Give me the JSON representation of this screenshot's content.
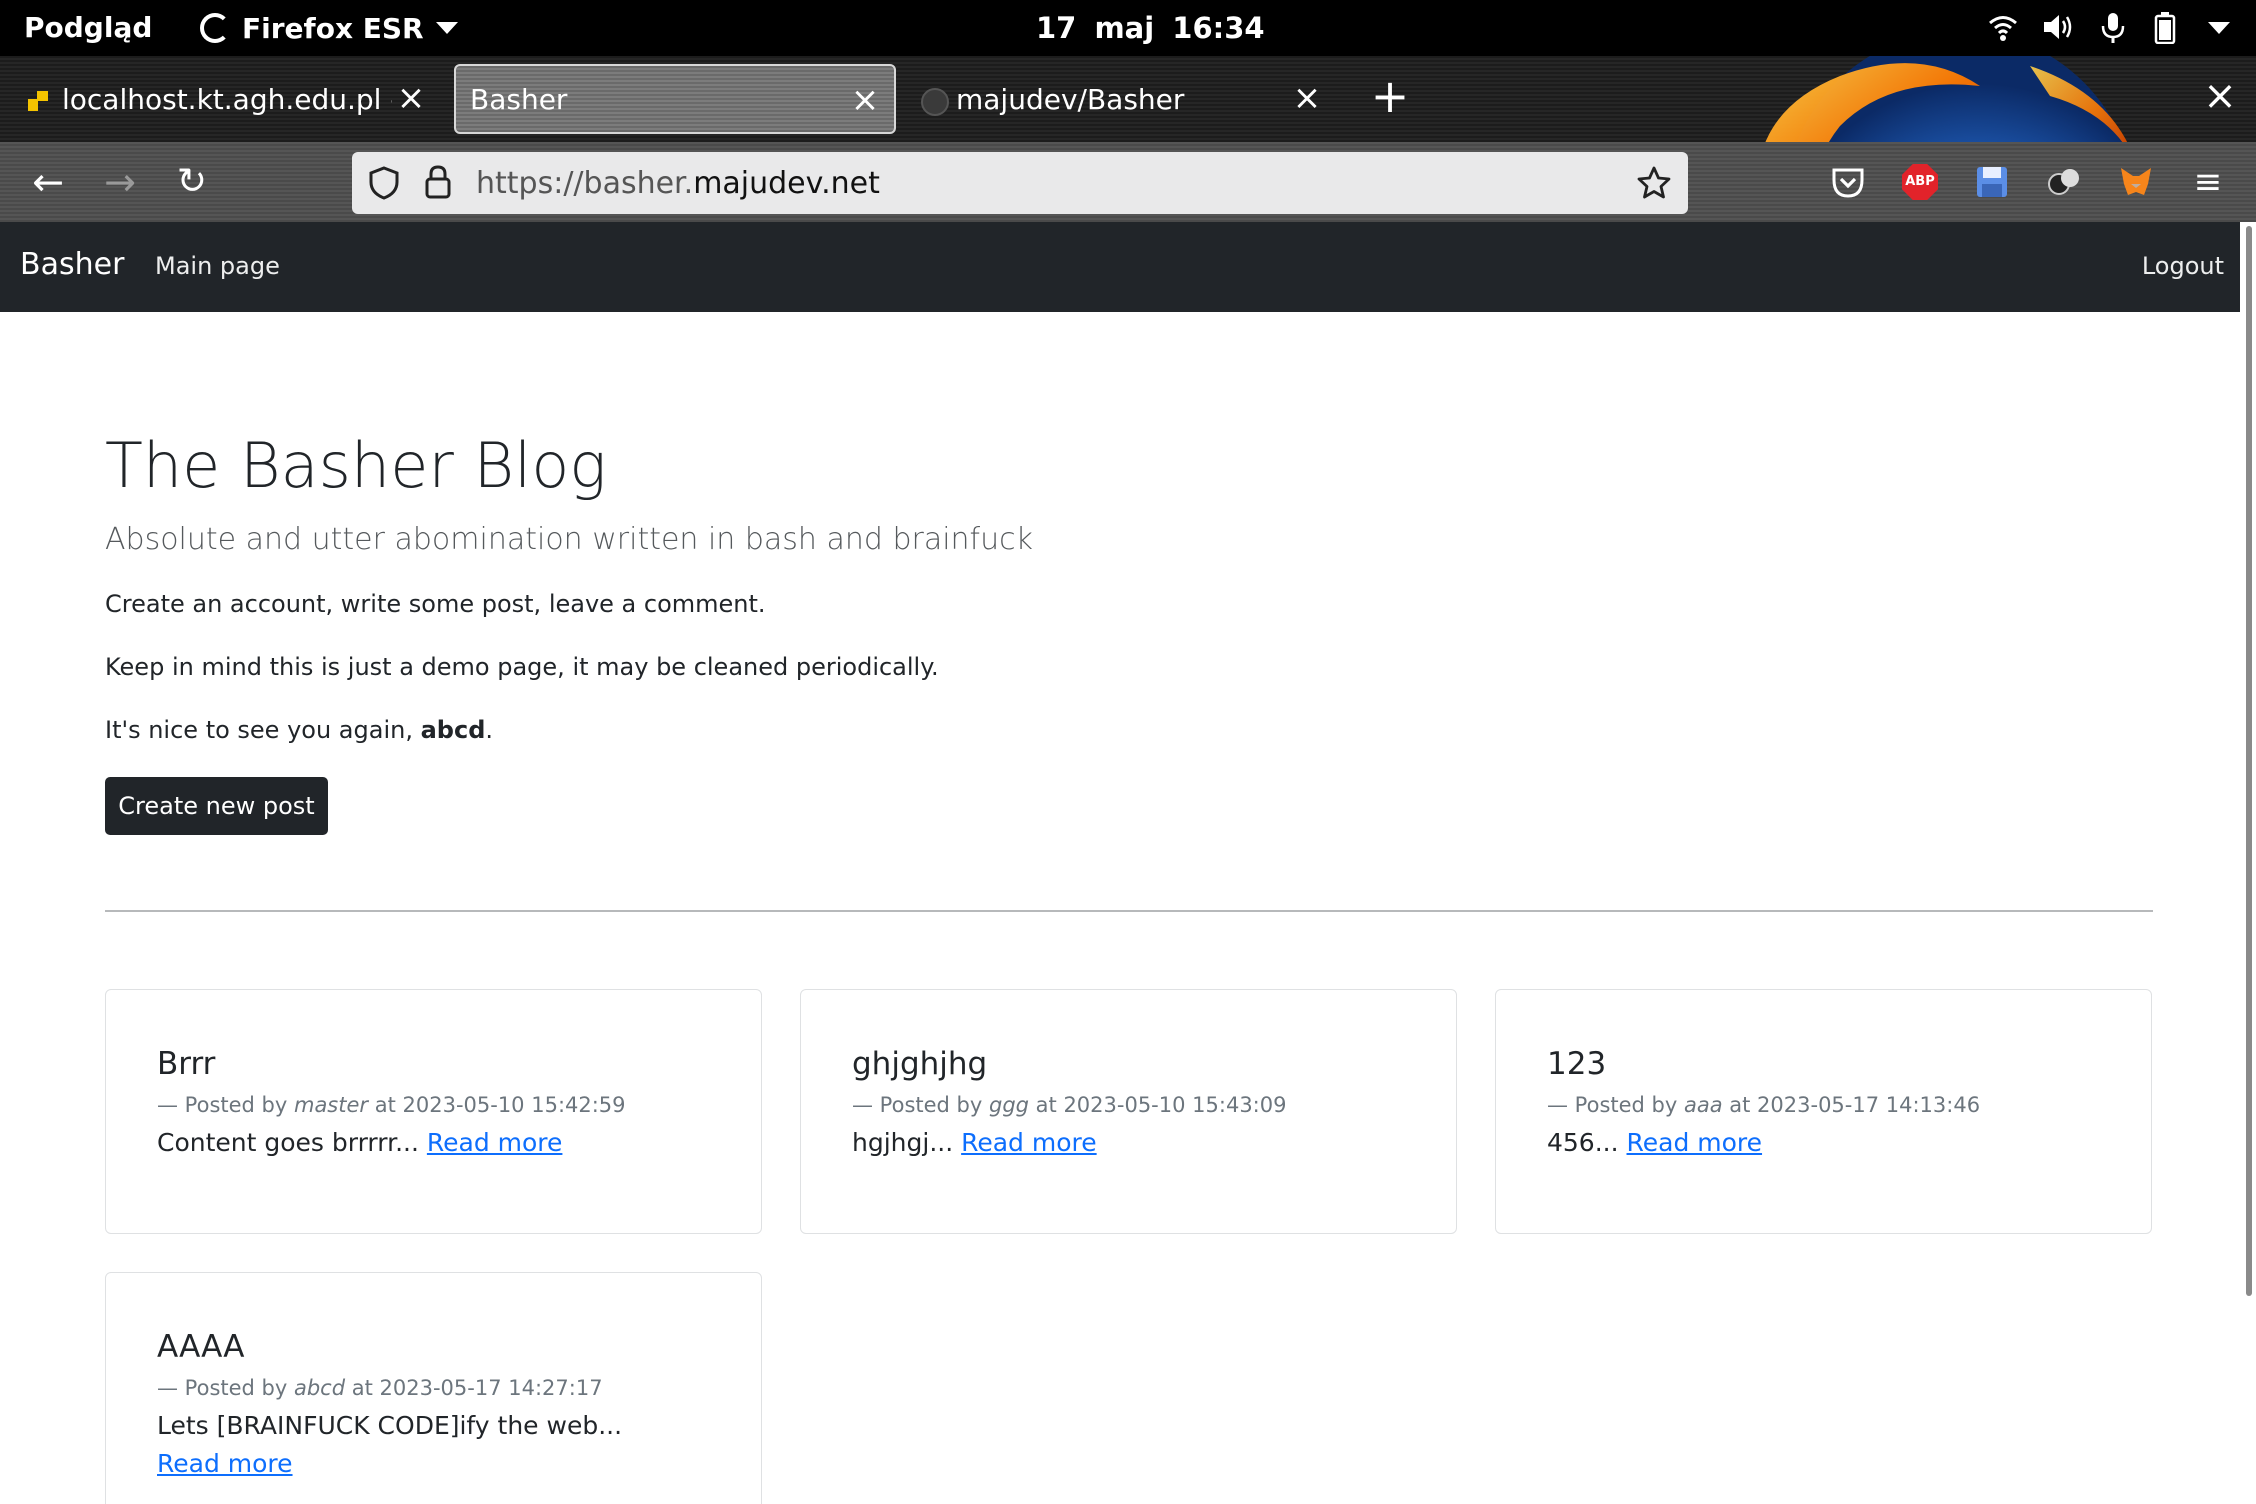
{
  "system_bar": {
    "activities": "Podgląd",
    "app_name": "Firefox ESR",
    "clock": "17 maj  16:34"
  },
  "browser": {
    "tabs": [
      {
        "label": "localhost.kt.agh.edu.pl - V",
        "active": false
      },
      {
        "label": "Basher",
        "active": true
      },
      {
        "label": "majudev/Basher",
        "active": false
      }
    ],
    "url_prefix": "https://basher.",
    "url_domain": "majudev.net",
    "extensions": [
      "pocket-icon",
      "adblock-plus-icon",
      "floppy-save-icon",
      "balls-extension-icon",
      "metamask-fox-icon"
    ],
    "extension_adblock_label": "ABP"
  },
  "site": {
    "brand": "Basher",
    "nav_main": "Main page",
    "nav_logout": "Logout",
    "title": "The Basher Blog",
    "lead": "Absolute and utter abomination written in bash and brainfuck",
    "p1": "Create an account, write some post, leave a comment.",
    "p2": "Keep in mind this is just a demo page, it may be cleaned periodically.",
    "greeting_prefix": "It's nice to see you again, ",
    "username": "abcd",
    "greeting_suffix": ".",
    "create_button": "Create new post",
    "read_more": "Read more"
  },
  "posts": [
    {
      "title": "Brrr",
      "meta_prefix": "— Posted by ",
      "author": "master",
      "meta_suffix": " at 2023-05-10 15:42:59",
      "excerpt": "Content goes brrrrr... "
    },
    {
      "title": "ghjghjhg",
      "meta_prefix": "— Posted by ",
      "author": "ggg",
      "meta_suffix": " at 2023-05-10 15:43:09",
      "excerpt": "hgjhgj... "
    },
    {
      "title": "123",
      "meta_prefix": "— Posted by ",
      "author": "aaa",
      "meta_suffix": " at 2023-05-17 14:13:46",
      "excerpt": "456... "
    },
    {
      "title": "AAAA",
      "meta_prefix": "— Posted by ",
      "author": "abcd",
      "meta_suffix": " at 2023-05-17 14:27:17",
      "excerpt": "Lets [BRAINFUCK CODE]ify the web... "
    }
  ],
  "colors": {
    "navbar_bg": "#212529",
    "link": "#0d6efd",
    "muted": "#6c757d",
    "adblock_red": "#e2232a"
  }
}
